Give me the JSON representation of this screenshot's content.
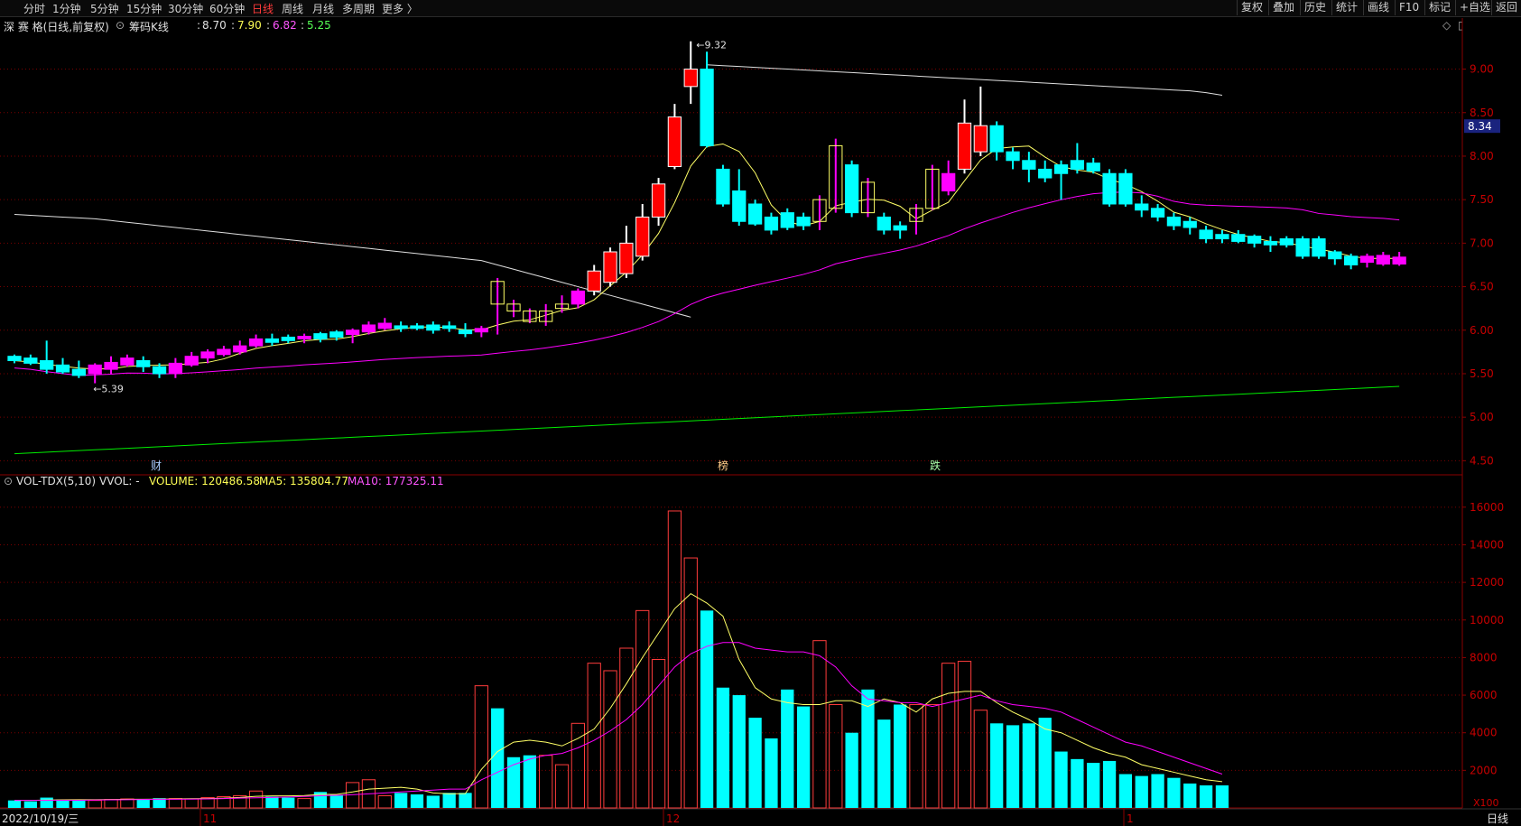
{
  "toolbar": {
    "periods": [
      "分时",
      "1分钟",
      "5分钟",
      "15分钟",
      "30分钟",
      "60分钟",
      "日线",
      "周线",
      "月线",
      "多周期",
      "更多 〉"
    ],
    "active_period": "日线",
    "right_buttons": [
      "复权",
      "叠加",
      "历史",
      "统计",
      "画线",
      "F10",
      "标记",
      "+自选",
      "返回"
    ]
  },
  "info": {
    "stock": "深 赛 格(日线,前复权)",
    "indicator": "筹码K线",
    "v1": "8.70",
    "v2": "7.90",
    "v3": "6.82",
    "v4": "5.25"
  },
  "main_chart": {
    "price_ticks": [
      "9.00",
      "8.50",
      "8.00",
      "7.50",
      "7.00",
      "6.50",
      "6.00",
      "5.50",
      "5.00",
      "4.50"
    ],
    "current_price_badge": "8.34",
    "high_marker": "9.32",
    "low_marker": "5.39",
    "event_labels": [
      "财",
      "榜",
      "跌"
    ],
    "colors": {
      "up": "#ff0000",
      "down": "#00ffff",
      "chip_up": "#ff00ff",
      "ma_yellow": "#ffff66",
      "ma_white": "#e0e0e0",
      "ma_magenta": "#ff00ff",
      "ma_green": "#00ee00",
      "grid": "#7a0000"
    }
  },
  "volume_panel": {
    "title": "VOL-TDX(5,10)",
    "vvol": "VVOL: -",
    "volume": "VOLUME: 120486.58",
    "ma5": "MA5: 135804.77",
    "ma10": "MA10: 177325.11",
    "ticks": [
      "16000",
      "14000",
      "12000",
      "10000",
      "8000",
      "6000",
      "4000",
      "2000"
    ],
    "unit": "X100"
  },
  "date_axis": {
    "start_date": "2022/10/19/三",
    "month_labels": [
      "11",
      "12",
      "1"
    ],
    "period_label": "日线"
  },
  "chart_data": {
    "type": "candlestick",
    "title": "深 赛 格",
    "ylim": [
      4.4,
      9.4
    ],
    "candles": [
      {
        "o": 5.7,
        "c": 5.65,
        "h": 5.72,
        "l": 5.62
      },
      {
        "o": 5.68,
        "c": 5.62,
        "h": 5.72,
        "l": 5.6
      },
      {
        "o": 5.65,
        "c": 5.55,
        "h": 5.88,
        "l": 5.5
      },
      {
        "o": 5.6,
        "c": 5.52,
        "h": 5.68,
        "l": 5.5
      },
      {
        "o": 5.55,
        "c": 5.48,
        "h": 5.65,
        "l": 5.45
      },
      {
        "o": 5.5,
        "c": 5.6,
        "h": 5.62,
        "l": 5.39
      },
      {
        "o": 5.55,
        "c": 5.63,
        "h": 5.7,
        "l": 5.5
      },
      {
        "o": 5.6,
        "c": 5.68,
        "h": 5.72,
        "l": 5.58
      },
      {
        "o": 5.65,
        "c": 5.58,
        "h": 5.7,
        "l": 5.52
      },
      {
        "o": 5.58,
        "c": 5.5,
        "h": 5.62,
        "l": 5.45
      },
      {
        "o": 5.5,
        "c": 5.62,
        "h": 5.68,
        "l": 5.45
      },
      {
        "o": 5.6,
        "c": 5.7,
        "h": 5.75,
        "l": 5.58
      },
      {
        "o": 5.68,
        "c": 5.75,
        "h": 5.78,
        "l": 5.62
      },
      {
        "o": 5.72,
        "c": 5.78,
        "h": 5.82,
        "l": 5.7
      },
      {
        "o": 5.75,
        "c": 5.82,
        "h": 5.88,
        "l": 5.72
      },
      {
        "o": 5.82,
        "c": 5.9,
        "h": 5.95,
        "l": 5.8
      },
      {
        "o": 5.9,
        "c": 5.86,
        "h": 5.96,
        "l": 5.82
      },
      {
        "o": 5.92,
        "c": 5.88,
        "h": 5.95,
        "l": 5.85
      },
      {
        "o": 5.9,
        "c": 5.93,
        "h": 5.96,
        "l": 5.85
      },
      {
        "o": 5.96,
        "c": 5.9,
        "h": 5.98,
        "l": 5.86
      },
      {
        "o": 5.98,
        "c": 5.92,
        "h": 6.0,
        "l": 5.88
      },
      {
        "o": 5.95,
        "c": 6.0,
        "h": 6.02,
        "l": 5.85
      },
      {
        "o": 5.98,
        "c": 6.06,
        "h": 6.1,
        "l": 5.95
      },
      {
        "o": 6.02,
        "c": 6.08,
        "h": 6.14,
        "l": 6.0
      },
      {
        "o": 6.05,
        "c": 6.02,
        "h": 6.1,
        "l": 5.98
      },
      {
        "o": 6.05,
        "c": 6.02,
        "h": 6.08,
        "l": 6.0
      },
      {
        "o": 6.06,
        "c": 6.0,
        "h": 6.1,
        "l": 5.96
      },
      {
        "o": 6.05,
        "c": 6.02,
        "h": 6.1,
        "l": 5.98
      },
      {
        "o": 6.0,
        "c": 5.96,
        "h": 6.08,
        "l": 5.92
      },
      {
        "o": 5.98,
        "c": 6.02,
        "h": 6.05,
        "l": 5.92
      },
      {
        "o": 6.56,
        "c": 6.3,
        "h": 6.6,
        "l": 5.95
      },
      {
        "o": 6.3,
        "c": 6.22,
        "h": 6.35,
        "l": 6.15
      },
      {
        "o": 6.22,
        "c": 6.1,
        "h": 6.25,
        "l": 6.08
      },
      {
        "o": 6.1,
        "c": 6.22,
        "h": 6.3,
        "l": 6.05
      },
      {
        "o": 6.25,
        "c": 6.3,
        "h": 6.4,
        "l": 6.2
      },
      {
        "o": 6.3,
        "c": 6.45,
        "h": 6.48,
        "l": 6.25
      },
      {
        "o": 6.45,
        "c": 6.68,
        "h": 6.75,
        "l": 6.4
      },
      {
        "o": 6.55,
        "c": 6.9,
        "h": 6.95,
        "l": 6.5
      },
      {
        "o": 6.65,
        "c": 7.0,
        "h": 7.2,
        "l": 6.6
      },
      {
        "o": 6.85,
        "c": 7.3,
        "h": 7.45,
        "l": 6.8
      },
      {
        "o": 7.3,
        "c": 7.68,
        "h": 7.75,
        "l": 7.2
      },
      {
        "o": 7.88,
        "c": 8.45,
        "h": 8.6,
        "l": 7.85
      },
      {
        "o": 8.8,
        "c": 9.0,
        "h": 9.32,
        "l": 8.6
      },
      {
        "o": 9.0,
        "c": 8.12,
        "h": 9.2,
        "l": 8.1
      },
      {
        "o": 7.85,
        "c": 7.45,
        "h": 7.9,
        "l": 7.42
      },
      {
        "o": 7.6,
        "c": 7.25,
        "h": 7.85,
        "l": 7.2
      },
      {
        "o": 7.45,
        "c": 7.22,
        "h": 7.5,
        "l": 7.2
      },
      {
        "o": 7.3,
        "c": 7.15,
        "h": 7.35,
        "l": 7.1
      },
      {
        "o": 7.35,
        "c": 7.18,
        "h": 7.4,
        "l": 7.15
      },
      {
        "o": 7.3,
        "c": 7.2,
        "h": 7.35,
        "l": 7.15
      },
      {
        "o": 7.25,
        "c": 7.5,
        "h": 7.55,
        "l": 7.15
      },
      {
        "o": 7.4,
        "c": 8.12,
        "h": 8.2,
        "l": 7.35
      },
      {
        "o": 7.9,
        "c": 7.35,
        "h": 7.95,
        "l": 7.3
      },
      {
        "o": 7.7,
        "c": 7.35,
        "h": 7.75,
        "l": 7.3
      },
      {
        "o": 7.3,
        "c": 7.15,
        "h": 7.35,
        "l": 7.1
      },
      {
        "o": 7.2,
        "c": 7.15,
        "h": 7.25,
        "l": 7.05
      },
      {
        "o": 7.25,
        "c": 7.4,
        "h": 7.45,
        "l": 7.1
      },
      {
        "o": 7.4,
        "c": 7.85,
        "h": 7.9,
        "l": 7.38
      },
      {
        "o": 7.6,
        "c": 7.8,
        "h": 7.95,
        "l": 7.55
      },
      {
        "o": 7.85,
        "c": 8.38,
        "h": 8.65,
        "l": 7.8
      },
      {
        "o": 8.05,
        "c": 8.35,
        "h": 8.8,
        "l": 8.0
      },
      {
        "o": 8.35,
        "c": 8.05,
        "h": 8.4,
        "l": 7.95
      },
      {
        "o": 8.05,
        "c": 7.95,
        "h": 8.1,
        "l": 7.85
      },
      {
        "o": 7.95,
        "c": 7.85,
        "h": 8.05,
        "l": 7.7
      },
      {
        "o": 7.85,
        "c": 7.75,
        "h": 7.95,
        "l": 7.7
      },
      {
        "o": 7.9,
        "c": 7.8,
        "h": 7.95,
        "l": 7.5
      },
      {
        "o": 7.95,
        "c": 7.85,
        "h": 8.15,
        "l": 7.8
      },
      {
        "o": 7.92,
        "c": 7.83,
        "h": 7.98,
        "l": 7.8
      },
      {
        "o": 7.8,
        "c": 7.45,
        "h": 7.85,
        "l": 7.42
      },
      {
        "o": 7.8,
        "c": 7.45,
        "h": 7.85,
        "l": 7.42
      },
      {
        "o": 7.45,
        "c": 7.38,
        "h": 7.55,
        "l": 7.3
      },
      {
        "o": 7.4,
        "c": 7.3,
        "h": 7.45,
        "l": 7.25
      },
      {
        "o": 7.3,
        "c": 7.2,
        "h": 7.35,
        "l": 7.15
      },
      {
        "o": 7.25,
        "c": 7.18,
        "h": 7.3,
        "l": 7.1
      },
      {
        "o": 7.15,
        "c": 7.05,
        "h": 7.2,
        "l": 7.0
      },
      {
        "o": 7.1,
        "c": 7.05,
        "h": 7.15,
        "l": 7.0
      },
      {
        "o": 7.1,
        "c": 7.02,
        "h": 7.15,
        "l": 7.0
      },
      {
        "o": 7.08,
        "c": 7.0,
        "h": 7.1,
        "l": 6.95
      },
      {
        "o": 7.02,
        "c": 6.98,
        "h": 7.08,
        "l": 6.9
      },
      {
        "o": 7.05,
        "c": 6.98,
        "h": 7.08,
        "l": 6.95
      },
      {
        "o": 7.05,
        "c": 6.85,
        "h": 7.08,
        "l": 6.82
      },
      {
        "o": 7.05,
        "c": 6.85,
        "h": 7.08,
        "l": 6.82
      },
      {
        "o": 6.9,
        "c": 6.82,
        "h": 6.92,
        "l": 6.75
      },
      {
        "o": 6.85,
        "c": 6.75,
        "h": 6.88,
        "l": 6.7
      },
      {
        "o": 6.78,
        "c": 6.85,
        "h": 6.88,
        "l": 6.72
      },
      {
        "o": 6.76,
        "c": 6.86,
        "h": 6.9,
        "l": 6.74
      },
      {
        "o": 6.76,
        "c": 6.84,
        "h": 6.9,
        "l": 6.74
      }
    ],
    "volumes": [
      400,
      350,
      550,
      450,
      420,
      400,
      450,
      480,
      450,
      520,
      500,
      480,
      550,
      600,
      650,
      900,
      600,
      550,
      500,
      850,
      700,
      1350,
      1500,
      650,
      800,
      720,
      650,
      800,
      800,
      6500,
      5300,
      2700,
      2800,
      2800,
      2300,
      4500,
      7700,
      7300,
      8500,
      10500,
      7900,
      15800,
      13300,
      10500,
      6400,
      6000,
      4800,
      3700,
      6300,
      5400,
      8900,
      5500,
      4000,
      6300,
      4700,
      5500,
      5500,
      5500,
      7700,
      7800,
      5200,
      4500,
      4400,
      4500,
      4800,
      3000,
      2600,
      2400,
      2500,
      1800,
      1700,
      1800,
      1600,
      1300,
      1200,
      1200
    ],
    "ma5_line": [
      400,
      400,
      420,
      430,
      440,
      440,
      450,
      460,
      460,
      470,
      480,
      490,
      500,
      520,
      560,
      620,
      640,
      640,
      660,
      720,
      720,
      850,
      1000,
      1050,
      1100,
      1000,
      800,
      750,
      760,
      2050,
      3000,
      3500,
      3600,
      3500,
      3300,
      3700,
      4200,
      5300,
      6600,
      8000,
      9300,
      10600,
      11400,
      10900,
      10200,
      7900,
      6400,
      5800,
      5600,
      5500,
      5500,
      5700,
      5700,
      5400,
      5800,
      5600,
      5100,
      5800,
      6100,
      6200,
      6200,
      5600,
      5100,
      4700,
      4200,
      4000,
      3600,
      3200,
      2900,
      2700,
      2300,
      2100,
      1900,
      1700,
      1500,
      1400
    ],
    "ma10_line": [
      400,
      400,
      400,
      410,
      410,
      420,
      430,
      440,
      450,
      460,
      460,
      470,
      480,
      500,
      520,
      540,
      560,
      580,
      610,
      650,
      670,
      700,
      750,
      800,
      850,
      900,
      950,
      1000,
      1000,
      1500,
      1900,
      2300,
      2600,
      2800,
      2900,
      3200,
      3600,
      4100,
      4700,
      5500,
      6500,
      7500,
      8200,
      8600,
      8800,
      8800,
      8500,
      8400,
      8300,
      8300,
      8100,
      7500,
      6500,
      5800,
      5700,
      5600,
      5600,
      5400,
      5600,
      5800,
      6000,
      5700,
      5500,
      5400,
      5300,
      5100,
      4700,
      4300,
      3900,
      3500,
      3300,
      3000,
      2700,
      2400,
      2100,
      1800
    ],
    "ma_white": [
      7.33,
      7.32,
      7.31,
      7.3,
      7.29,
      7.28,
      7.26,
      7.24,
      7.22,
      7.2,
      7.18,
      7.16,
      7.14,
      7.12,
      7.1,
      7.08,
      7.06,
      7.04,
      7.02,
      7.0,
      6.98,
      6.96,
      6.94,
      6.92,
      6.9,
      6.88,
      6.86,
      6.84,
      6.82,
      6.8,
      6.75,
      6.7,
      6.65,
      6.6,
      6.55,
      6.5,
      6.45,
      6.4,
      6.35,
      6.3,
      6.25,
      6.2,
      6.15,
      9.05,
      9.04,
      9.03,
      9.02,
      9.01,
      9.0,
      8.99,
      8.98,
      8.97,
      8.96,
      8.95,
      8.94,
      8.93,
      8.92,
      8.91,
      8.9,
      8.89,
      8.88,
      8.87,
      8.86,
      8.85,
      8.84,
      8.83,
      8.82,
      8.81,
      8.8,
      8.79,
      8.78,
      8.77,
      8.76,
      8.75,
      8.73,
      8.7
    ]
  }
}
